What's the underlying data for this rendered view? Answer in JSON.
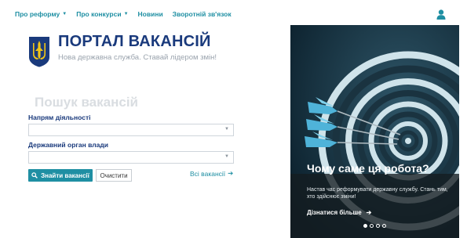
{
  "nav": {
    "items": [
      {
        "label": "Про реформу",
        "dropdown": true
      },
      {
        "label": "Про конкурси",
        "dropdown": true
      },
      {
        "label": "Новини",
        "dropdown": false
      },
      {
        "label": "Зворотній зв'язок",
        "dropdown": false
      }
    ],
    "user_icon": "user-icon"
  },
  "header": {
    "title": "ПОРТАЛ ВАКАНСІЙ",
    "tagline": "Нова державна служба. Ставай лідером змін!",
    "logo_icon": "trident-shield-icon"
  },
  "search": {
    "title": "Пошук вакансій",
    "field1_label": "Напрям діяльності",
    "field1_value": "",
    "field2_label": "Державний орган влади",
    "field2_value": "",
    "search_button": "Знайти вакансії",
    "clear_button": "Очистити",
    "all_vacancies_link": "Всі вакансії"
  },
  "hero": {
    "title": "Чому саме ця робота?",
    "description": "Настав час реформувати державну службу. Стань тим, хто здійснює зміни!",
    "more_link": "Дізнатися більше",
    "slides": 4,
    "active_slide": 1
  },
  "colors": {
    "accent": "#1f8fa3",
    "brand": "#1a3a7c"
  }
}
